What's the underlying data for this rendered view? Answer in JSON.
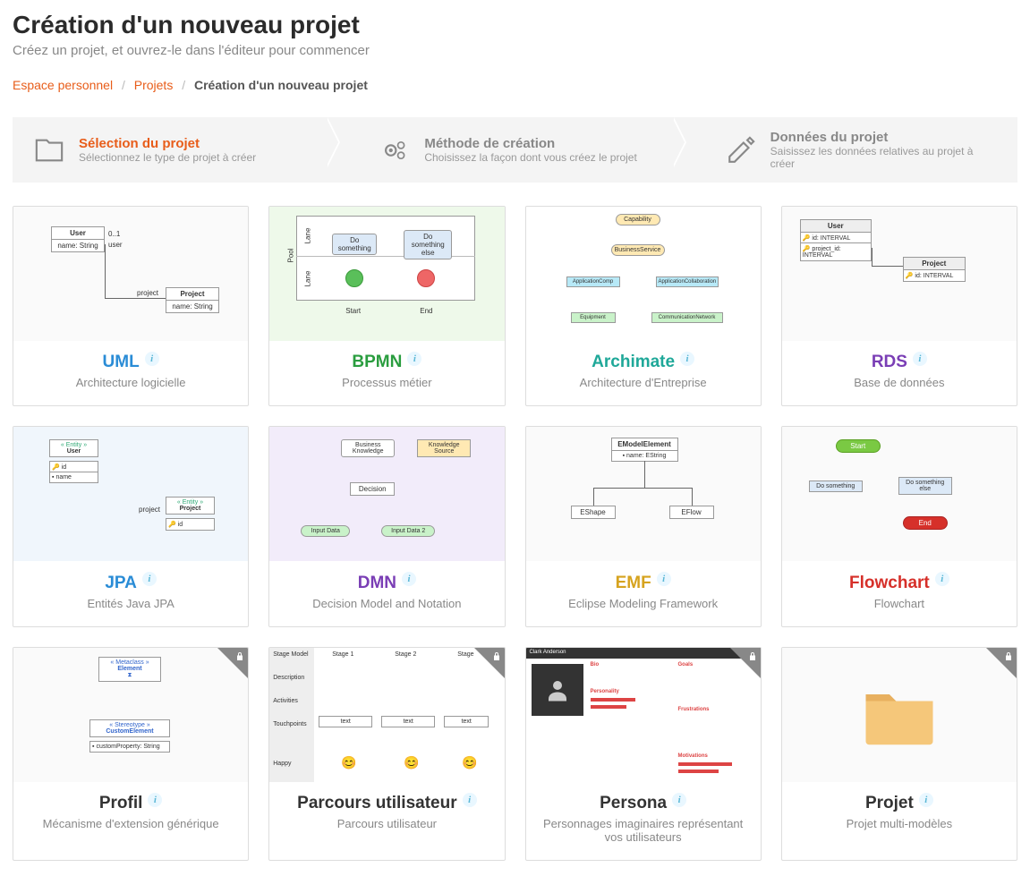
{
  "header": {
    "title": "Création d'un nouveau projet",
    "subtitle": "Créez un projet, et ouvrez-le dans l'éditeur pour commencer"
  },
  "breadcrumb": {
    "items": [
      {
        "label": "Espace personnel",
        "link": true
      },
      {
        "label": "Projets",
        "link": true
      },
      {
        "label": "Création d'un nouveau projet",
        "link": false
      }
    ]
  },
  "wizard": [
    {
      "title": "Sélection du projet",
      "desc": "Sélectionnez le type de projet à créer",
      "active": true,
      "icon": "folder"
    },
    {
      "title": "Méthode de création",
      "desc": "Choisissez la façon dont vous créez le projet",
      "active": false,
      "icon": "gears"
    },
    {
      "title": "Données du projet",
      "desc": "Saisissez les données relatives au projet à créer",
      "active": false,
      "icon": "edit"
    }
  ],
  "cards": [
    {
      "title": "UML",
      "desc": "Architecture logicielle",
      "color": "c-blue",
      "locked": false
    },
    {
      "title": "BPMN",
      "desc": "Processus métier",
      "color": "c-green",
      "locked": false
    },
    {
      "title": "Archimate",
      "desc": "Architecture d'Entreprise",
      "color": "c-teal",
      "locked": false
    },
    {
      "title": "RDS",
      "desc": "Base de données",
      "color": "c-purple",
      "locked": false
    },
    {
      "title": "JPA",
      "desc": "Entités Java JPA",
      "color": "c-blue",
      "locked": false
    },
    {
      "title": "DMN",
      "desc": "Decision Model and Notation",
      "color": "c-purple",
      "locked": false
    },
    {
      "title": "EMF",
      "desc": "Eclipse Modeling Framework",
      "color": "c-amber",
      "locked": false
    },
    {
      "title": "Flowchart",
      "desc": "Flowchart",
      "color": "c-red",
      "locked": false
    },
    {
      "title": "Profil",
      "desc": "Mécanisme d'extension générique",
      "color": "c-dark",
      "locked": true
    },
    {
      "title": "Parcours utilisateur",
      "desc": "Parcours utilisateur",
      "color": "c-dark",
      "locked": true
    },
    {
      "title": "Persona",
      "desc": "Personnages imaginaires représentant vos utilisateurs",
      "color": "c-dark",
      "locked": true
    },
    {
      "title": "Projet",
      "desc": "Projet multi-modèles",
      "color": "c-dark",
      "locked": true
    }
  ],
  "previews": {
    "uml": {
      "user": "User",
      "name": "name: String",
      "project": "Project",
      "mult": "0..1",
      "role1": "user",
      "role2": "project"
    },
    "bpmn": {
      "pool": "Pool",
      "lane": "Lane",
      "task1": "Do something",
      "task2": "Do something else",
      "start": "Start",
      "end": "End"
    },
    "archimate": {
      "cap": "Capability",
      "svc": "BusinessService",
      "app1": "ApplicationComp",
      "app2": "ApplicationCollaboration",
      "eq": "Equipment",
      "net": "CommunicationNetwork"
    },
    "rds": {
      "user": "User",
      "project": "Project",
      "id": "id: INTERVAL",
      "pid": "project_id: INTERVAL"
    },
    "jpa": {
      "ent": "« Entity »",
      "user": "User",
      "project": "Project",
      "id": "id",
      "name": "name",
      "role": "project"
    },
    "dmn": {
      "bk": "Business Knowledge",
      "ks": "Knowledge Source",
      "dec": "Decision",
      "in1": "Input Data",
      "in2": "Input Data 2"
    },
    "emf": {
      "root": "EModelElement",
      "attr": "name: EString",
      "l": "EShape",
      "r": "EFlow"
    },
    "flowchart": {
      "start": "Start",
      "t1": "Do something",
      "t2": "Do something else",
      "end": "End"
    },
    "profil": {
      "meta": "« Metaclass »",
      "el": "Element",
      "stereo": "« Stereotype »",
      "ce": "CustomElement",
      "prop": "customProperty: String"
    },
    "journey": {
      "sm": "Stage Model",
      "s1": "Stage 1",
      "s2": "Stage 2",
      "stage": "Stage",
      "desc": "Description",
      "act": "Activities",
      "tp": "Touchpoints",
      "happy": "Happy",
      "text": "text"
    },
    "persona": {
      "name": "Clark Anderson",
      "bio": "Bio",
      "pers": "Personality",
      "goals": "Goals",
      "frust": "Frustrations",
      "motiv": "Motivations"
    }
  }
}
